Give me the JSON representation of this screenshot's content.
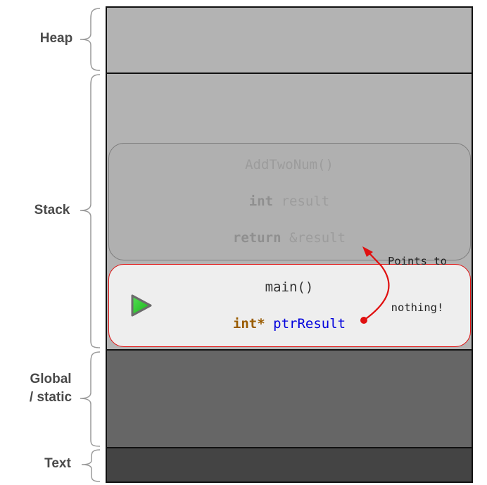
{
  "segments": {
    "heap": {
      "label": "Heap"
    },
    "stack": {
      "label": "Stack"
    },
    "global": {
      "label_line1": "Global",
      "label_line2": "/ static"
    },
    "text": {
      "label": "Text"
    }
  },
  "frames": {
    "add_two_num": {
      "title": "AddTwoNum()",
      "line1_keyword": "int",
      "line1_rest": " result",
      "line2_keyword": "return",
      "line2_rest": " &result"
    },
    "main": {
      "title": "main()",
      "line1_keyword": "int*",
      "line1_rest": " ptrResult"
    }
  },
  "annotation": {
    "line1": "Points to",
    "line2": "nothing!"
  },
  "colors": {
    "heap_fill": "#b3b3b3",
    "stack_fill": "#b3b3b3",
    "global_fill": "#666666",
    "text_fill": "#444444",
    "inactive_frame": "#aaaaaa",
    "active_frame_fill": "#eeeeee",
    "active_frame_border": "#e01010",
    "pointer_arrow": "#e01010",
    "keyword": "#9a5c00",
    "identifier": "#0000dd",
    "play_icon": "#33cc33"
  },
  "icons": {
    "current_frame": "play-icon",
    "brace": "curly-brace-icon"
  }
}
